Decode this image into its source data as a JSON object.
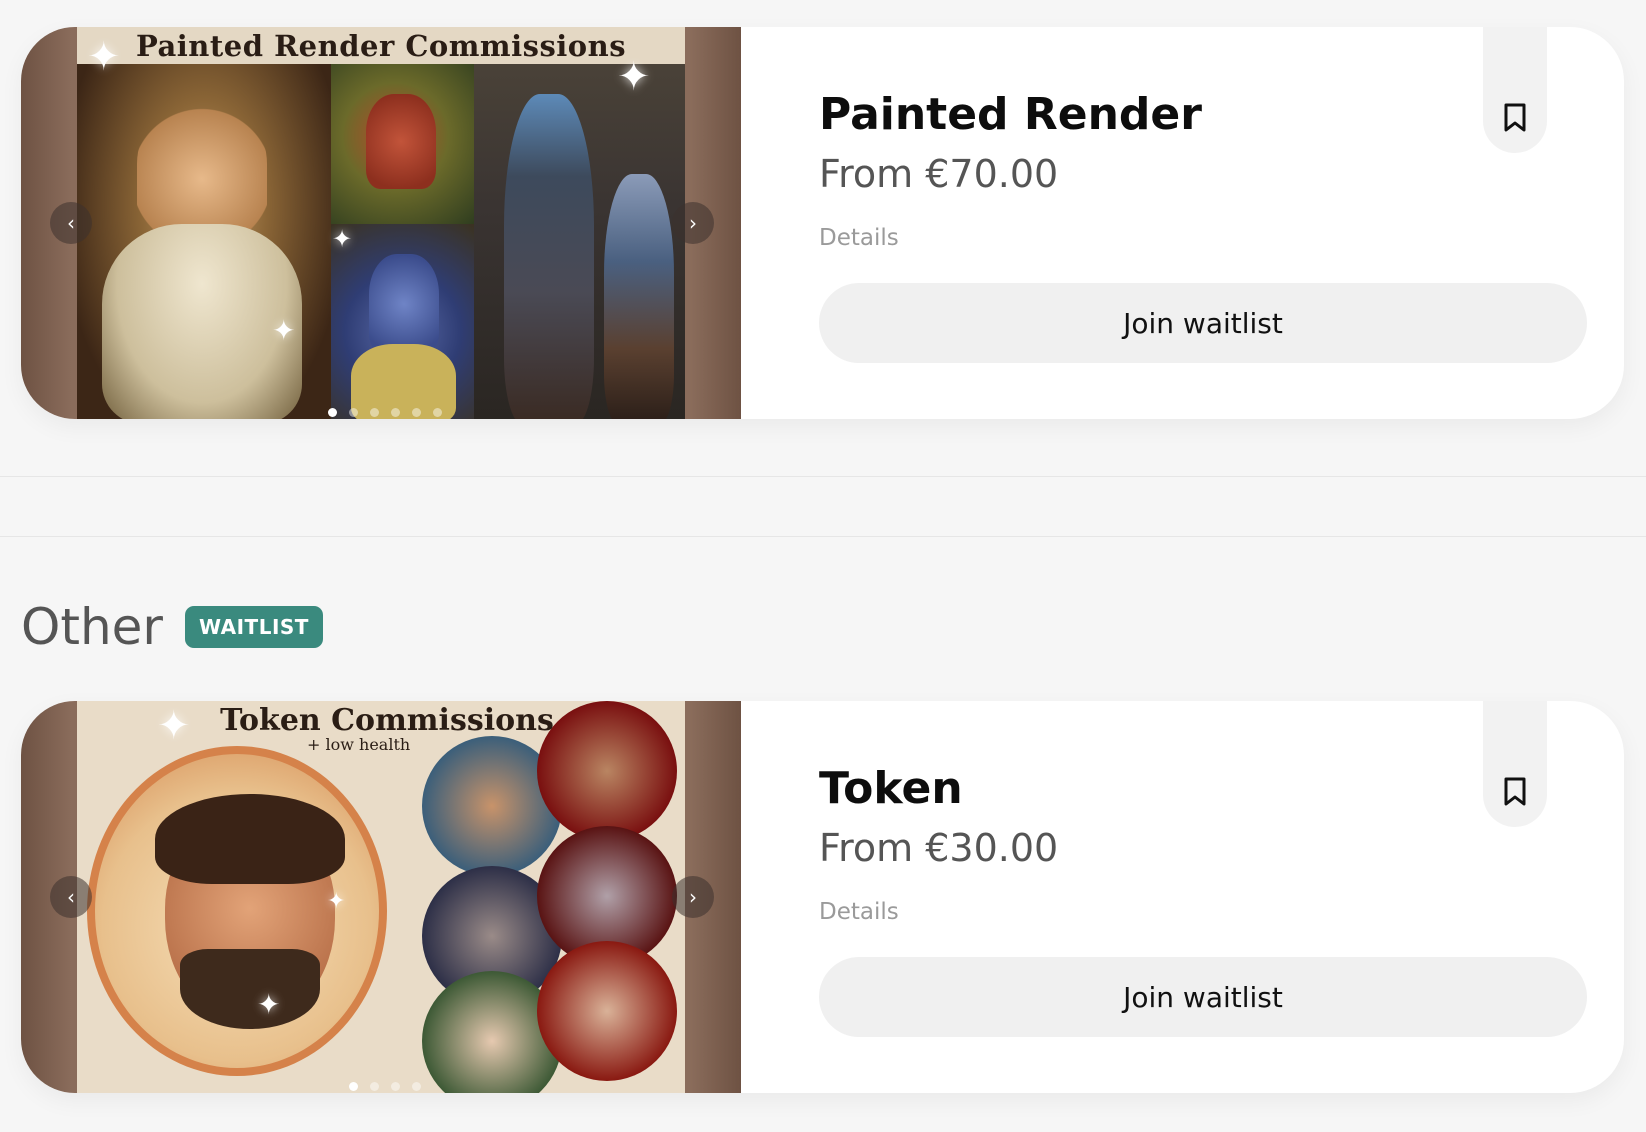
{
  "listings": [
    {
      "image_banner": "Painted Render Commissions",
      "title": "Painted Render",
      "price": "From €70.00",
      "details": "Details",
      "cta": "Join waitlist",
      "dots_total": 6,
      "dots_active": 0
    },
    {
      "image_banner": "Token Commissions",
      "image_subtitle": "+ low health",
      "title": "Token",
      "price": "From €30.00",
      "details": "Details",
      "cta": "Join waitlist",
      "dots_total": 4,
      "dots_active": 0
    }
  ],
  "section": {
    "title": "Other",
    "badge": "WAITLIST"
  },
  "icons": {
    "prev": "chevron-left-icon",
    "next": "chevron-right-icon",
    "bookmark": "bookmark-icon"
  },
  "colors": {
    "badge": "#3a8a7e",
    "button_bg": "#f0f0f0",
    "page_bg": "#f6f6f6"
  }
}
